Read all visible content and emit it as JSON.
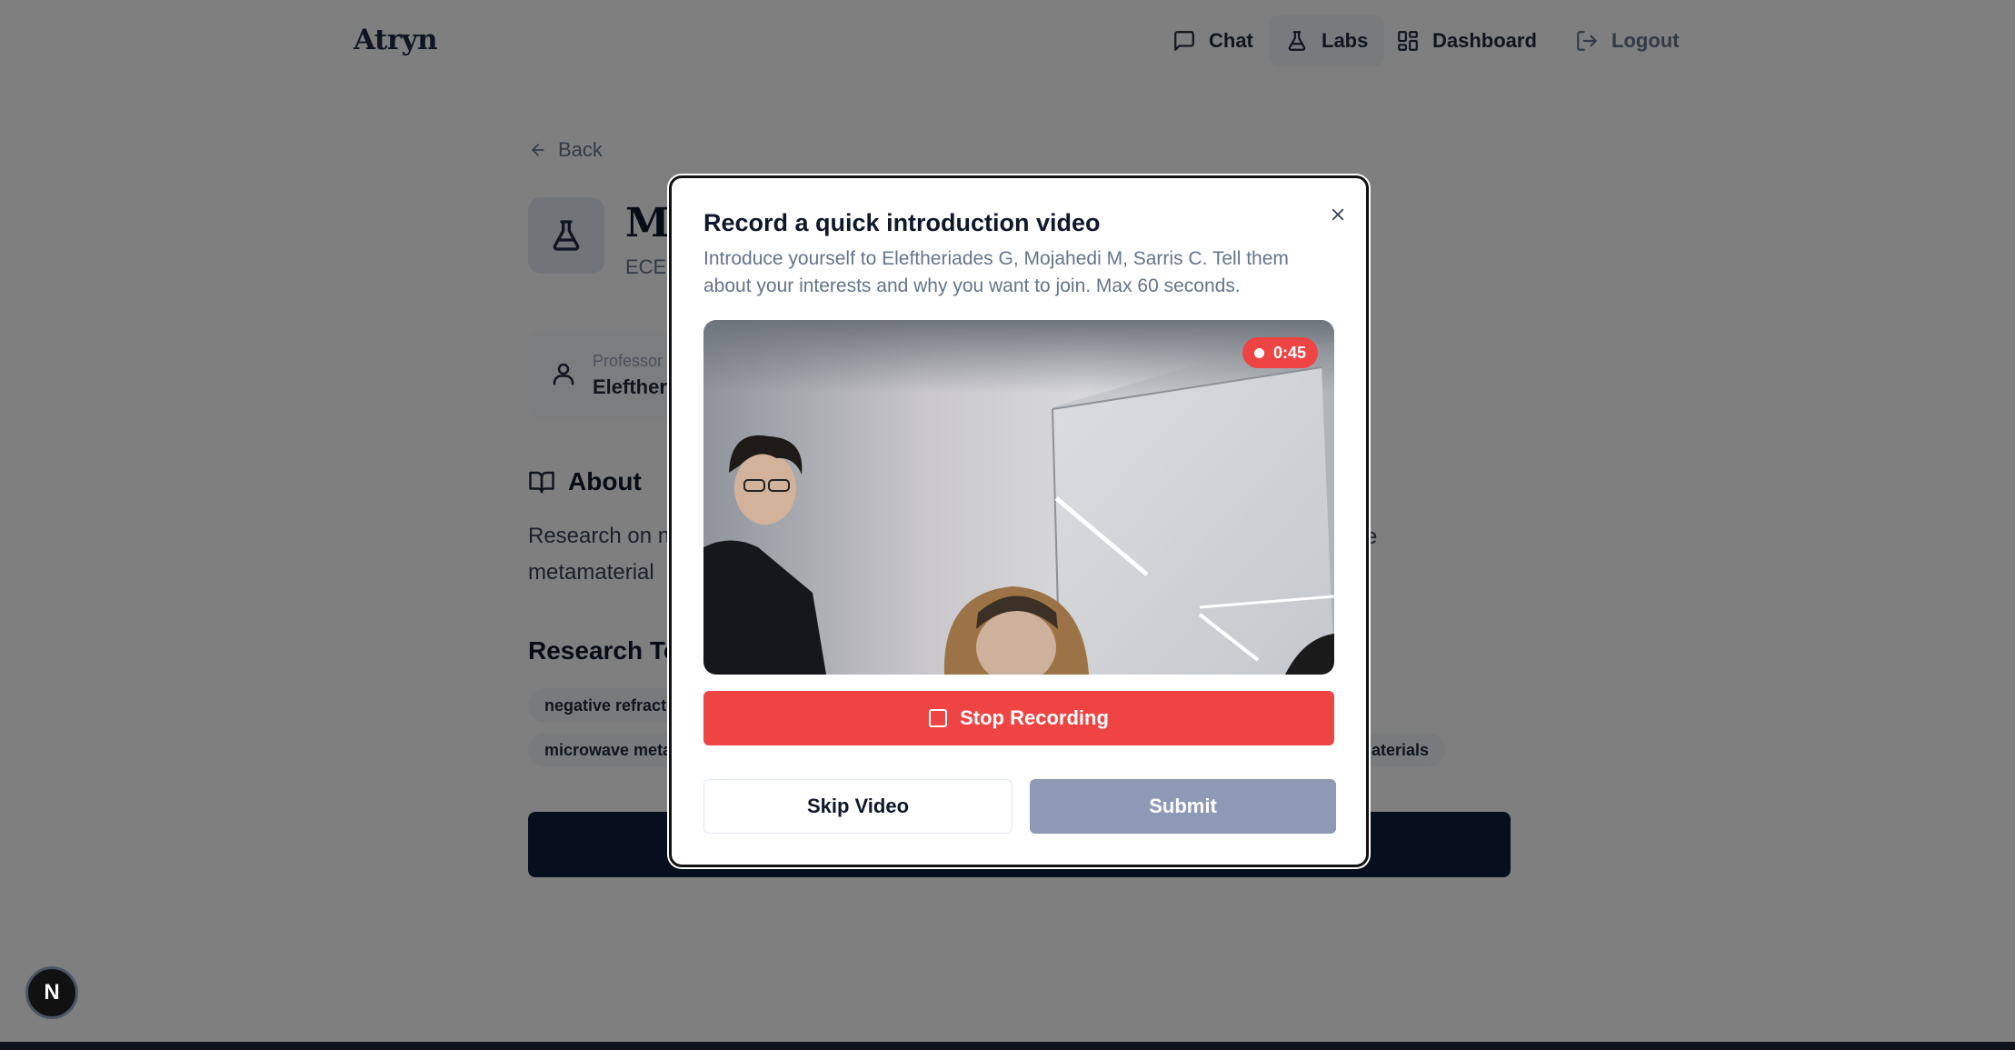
{
  "nav": {
    "logo": "Atryn",
    "items": [
      {
        "label": "Chat",
        "icon": "chat-icon"
      },
      {
        "label": "Labs",
        "icon": "flask-icon",
        "active": true
      },
      {
        "label": "Dashboard",
        "icon": "dashboard-icon"
      },
      {
        "label": "Logout",
        "icon": "logout-icon"
      }
    ]
  },
  "page": {
    "back_label": "Back",
    "lab_title": "Me",
    "lab_dept": "ECE,",
    "professor_label": "Professor",
    "professor_name": "Eleftheri",
    "about_heading": "About",
    "about_text_line1": "Research on ne",
    "about_text_line2": "metamaterial",
    "about_text_tail": "ve",
    "topics_heading": "Research To",
    "topics": [
      "negative refract",
      "microwave meta",
      "naterials"
    ]
  },
  "modal": {
    "title": "Record a quick introduction video",
    "description": "Introduce yourself to Eleftheriades G, Mojahedi M, Sarris C. Tell them about your interests and why you want to join. Max 60 seconds.",
    "timer": "0:45",
    "stop_label": "Stop Recording",
    "skip_label": "Skip Video",
    "submit_label": "Submit",
    "submit_disabled": true
  },
  "dev_badge": "N",
  "colors": {
    "record_red": "#ef4444",
    "primary_navy": "#0f1d3d",
    "submit_disabled": "#8e9ab5",
    "muted_text": "#64748b"
  }
}
